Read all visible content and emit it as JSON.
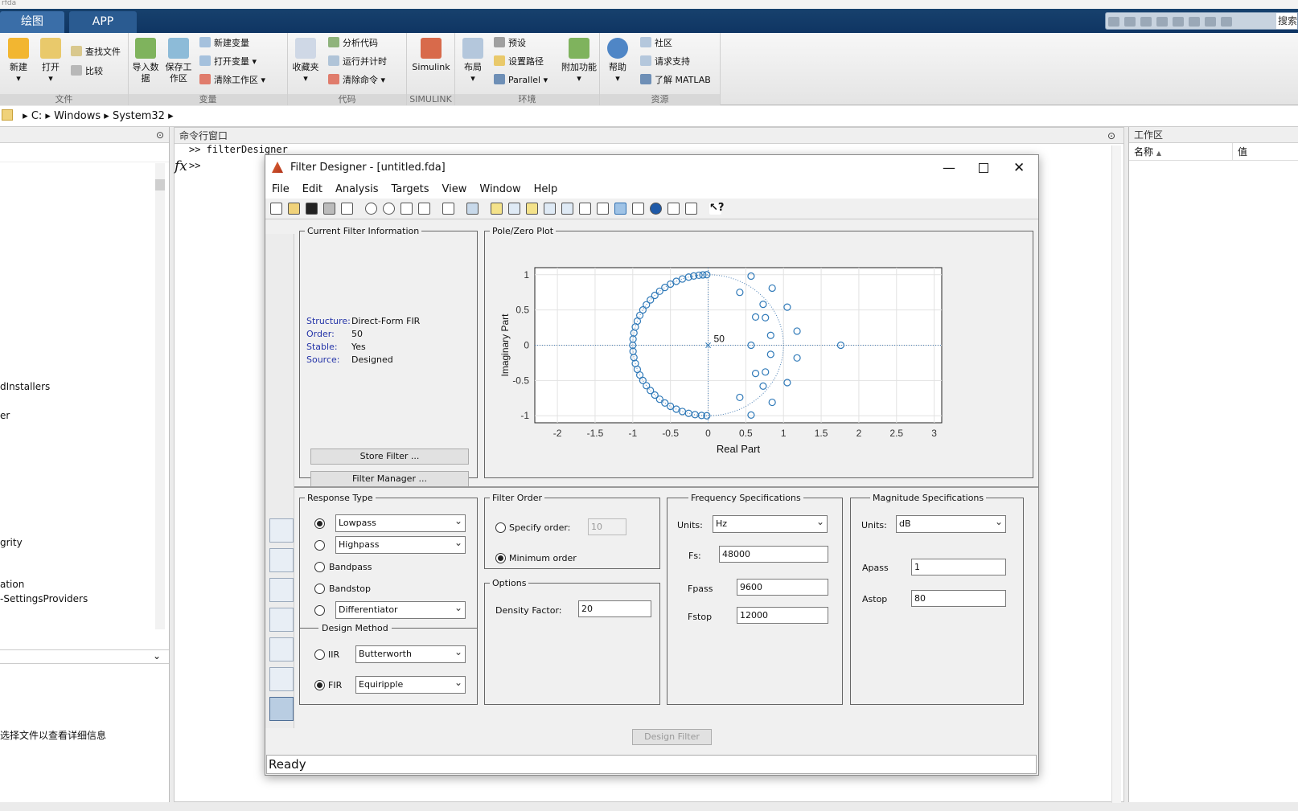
{
  "app": {
    "title_fragment": "rfda"
  },
  "tabs": [
    "绘图",
    "APP"
  ],
  "quick_access": {
    "search": "搜索"
  },
  "ribbon": {
    "file": {
      "label": "文件",
      "new": "新建",
      "open": "打开",
      "find": "查找文件",
      "compare": "比较"
    },
    "variable": {
      "label": "变量",
      "import": "导入数据",
      "save": "保存工作区",
      "new_var": "新建变量",
      "open_var": "打开变量",
      "clear_ws": "清除工作区"
    },
    "code": {
      "label": "代码",
      "favorites": "收藏夹",
      "analyze": "分析代码",
      "run_time": "运行并计时",
      "clear_cmd": "清除命令"
    },
    "simulink": {
      "label": "SIMULINK",
      "simulink": "Simulink"
    },
    "env": {
      "label": "环境",
      "layout": "布局",
      "prefs": "预设",
      "set_path": "设置路径",
      "parallel": "Parallel",
      "addons": "附加功能"
    },
    "res": {
      "label": "资源",
      "help": "帮助",
      "community": "社区",
      "support": "请求支持",
      "learn": "了解 MATLAB"
    }
  },
  "address": {
    "parts": [
      "C:",
      "Windows",
      "System32"
    ]
  },
  "left_panel": {
    "items": [
      "dInstallers",
      "er",
      "grity",
      "ation",
      "-SettingsProviders"
    ],
    "detail_hint": "选择文件以查看详细信息"
  },
  "command_window": {
    "title": "命令行窗口",
    "line1": ">> filterDesigner",
    "prompt": ">>",
    "fx": "fx"
  },
  "workspace": {
    "title": "工作区",
    "col_name": "名称",
    "col_value": "值"
  },
  "fd": {
    "title": "Filter Designer - [untitled.fda]",
    "menu": [
      "File",
      "Edit",
      "Analysis",
      "Targets",
      "View",
      "Window",
      "Help"
    ],
    "info": {
      "legend": "Current Filter Information",
      "rows": [
        [
          "Structure:",
          "Direct-Form FIR"
        ],
        [
          "Order:",
          "50"
        ],
        [
          "Stable:",
          "Yes"
        ],
        [
          "Source:",
          "Designed"
        ]
      ],
      "store": "Store Filter ...",
      "manager": "Filter Manager ..."
    },
    "response": {
      "legend": "Response Type",
      "lowpass": "Lowpass",
      "highpass": "Highpass",
      "bandpass": "Bandpass",
      "bandstop": "Bandstop",
      "differentiator": "Differentiator"
    },
    "method": {
      "legend": "Design Method",
      "iir": "IIR",
      "iir_val": "Butterworth",
      "fir": "FIR",
      "fir_val": "Equiripple"
    },
    "order": {
      "legend": "Filter Order",
      "specify": "Specify order:",
      "specify_val": "10",
      "minimum": "Minimum order"
    },
    "options": {
      "legend": "Options",
      "density": "Density Factor:",
      "density_val": "20"
    },
    "freq": {
      "legend": "Frequency Specifications",
      "units_label": "Units:",
      "units": "Hz",
      "fs_label": "Fs:",
      "fs": "48000",
      "fpass_label": "Fpass",
      "fpass": "9600",
      "fstop_label": "Fstop",
      "fstop": "12000"
    },
    "mag": {
      "legend": "Magnitude Specifications",
      "units_label": "Units:",
      "units": "dB",
      "apass_label": "Apass",
      "apass": "1",
      "astop_label": "Astop",
      "astop": "80"
    },
    "design": "Design Filter",
    "status": "Ready"
  },
  "chart_data": {
    "type": "scatter",
    "title": "Pole/Zero Plot",
    "xlabel": "Real Part",
    "ylabel": "Imaginary Part",
    "xlim": [
      -2.3,
      3.1
    ],
    "ylim": [
      -1.1,
      1.1
    ],
    "xticks": [
      -2,
      -1.5,
      -1,
      -0.5,
      0,
      0.5,
      1,
      1.5,
      2,
      2.5,
      3
    ],
    "yticks": [
      -1,
      -0.5,
      0,
      0.5,
      1
    ],
    "grid": true,
    "unit_circle": true,
    "pole_annotation": "50",
    "poles": [
      [
        0,
        0
      ]
    ],
    "zeros_unit_circle_angles_deg": [
      91,
      94,
      97,
      101,
      105,
      110,
      115,
      120,
      125,
      130,
      135,
      140,
      145,
      150,
      155,
      160,
      165,
      170,
      175,
      180,
      185,
      190,
      195,
      200,
      205,
      210,
      215,
      220,
      225,
      230,
      235,
      240,
      245,
      250,
      255,
      260,
      265,
      269
    ],
    "zeros_other": [
      [
        0.57,
        0.98
      ],
      [
        0.85,
        0.81
      ],
      [
        1.05,
        0.54
      ],
      [
        1.18,
        0.2
      ],
      [
        0.42,
        0.75
      ],
      [
        0.76,
        0.39
      ],
      [
        0.83,
        0.14
      ],
      [
        0.57,
        0
      ],
      [
        1.76,
        0
      ],
      [
        1.18,
        -0.18
      ],
      [
        1.05,
        -0.53
      ],
      [
        0.85,
        -0.81
      ],
      [
        0.57,
        -0.99
      ],
      [
        0.42,
        -0.74
      ],
      [
        0.76,
        -0.38
      ],
      [
        0.83,
        -0.13
      ],
      [
        0.63,
        0.4
      ],
      [
        0.63,
        -0.4
      ],
      [
        0.73,
        -0.58
      ],
      [
        0.73,
        0.58
      ]
    ]
  }
}
